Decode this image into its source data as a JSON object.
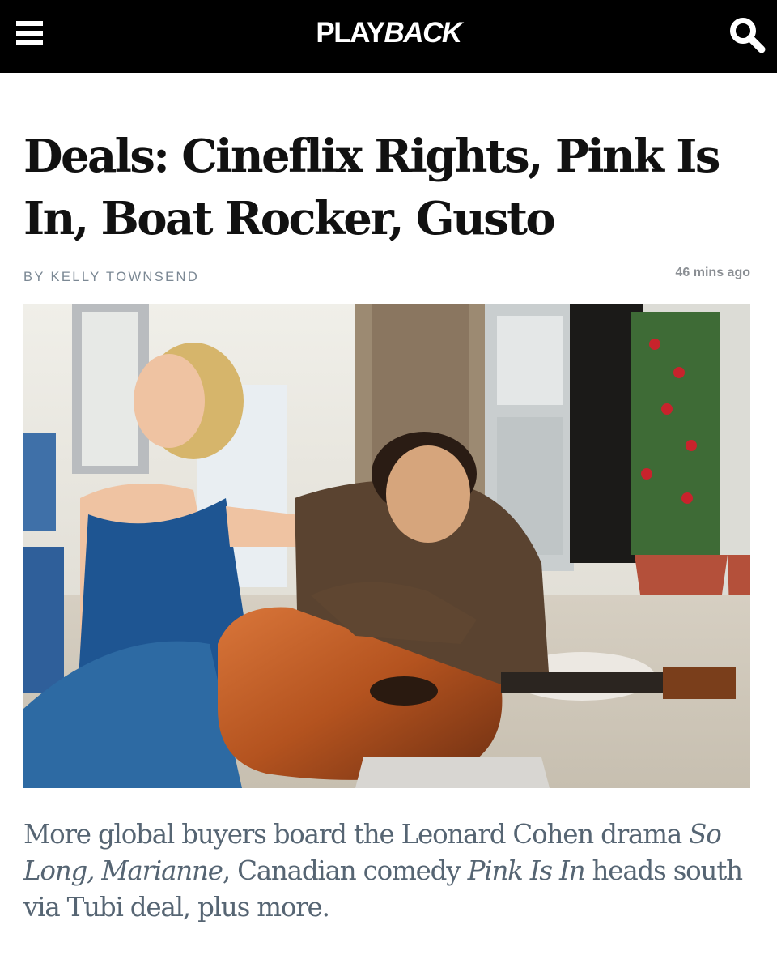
{
  "header": {
    "logo_part1": "PLAY",
    "logo_part2": "BACK",
    "menu_icon": "hamburger-menu-icon",
    "search_icon": "search-icon",
    "background": "#000000"
  },
  "article": {
    "title": "Deals: Cineflix Rights, Pink Is In, Boat Rocker, Gusto",
    "byline": "BY KELLY TOWNSEND",
    "timestamp": "46 mins ago",
    "dek": {
      "part1": "More global buyers board the Leonard Cohen drama ",
      "title1": "So Long, Marianne",
      "part2": ", Canadian comedy ",
      "title2": "Pink Is In",
      "part3": " heads south via Tubi deal, plus more."
    }
  },
  "colors": {
    "dek_text": "#566573",
    "byline": "#7b8894",
    "headline": "#111111"
  }
}
